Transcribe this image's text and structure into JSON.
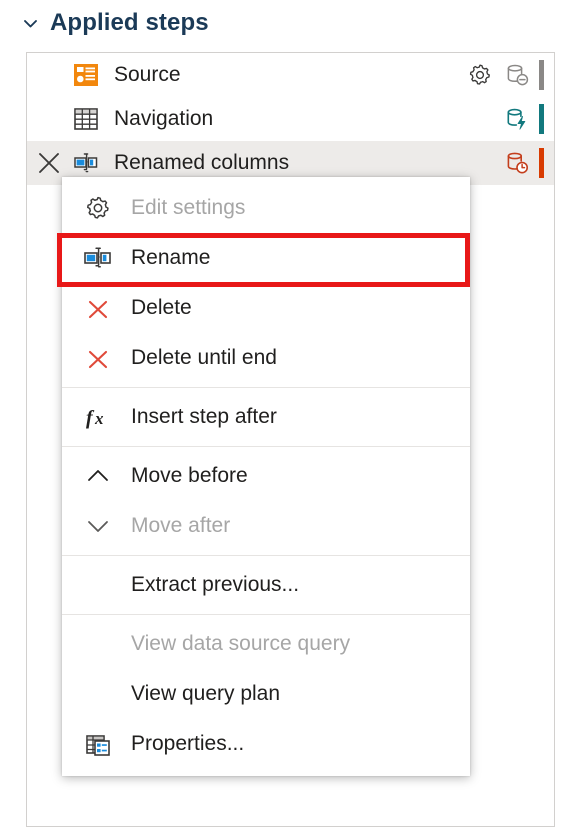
{
  "header": {
    "title": "Applied steps",
    "chevron_icon": "chevron-down-icon",
    "title_color": "#1b3a57"
  },
  "steps_panel": {
    "border_color": "#d2d0ce",
    "selected_row_bg": "#edebe9",
    "steps": [
      {
        "label": "Source",
        "type_icon": "source-orange-icon",
        "type_icon_color": "#f2870d",
        "has_gear": true,
        "gear_icon": "gear-icon",
        "status_icon": "database-disabled-icon",
        "status_color": "#8a8886",
        "accent_color": "#8a8886",
        "selected": false,
        "has_delete": false
      },
      {
        "label": "Navigation",
        "type_icon": "table-grid-icon",
        "type_icon_color": "#3b3a39",
        "has_gear": false,
        "gear_icon": "",
        "status_icon": "database-folding-icon",
        "status_color": "#12797e",
        "accent_color": "#12797e",
        "selected": false,
        "has_delete": false
      },
      {
        "label": "Renamed columns",
        "type_icon": "rename-columns-icon",
        "type_icon_color": "#0f6cbd",
        "has_gear": false,
        "gear_icon": "",
        "status_icon": "database-pending-icon",
        "status_color": "#c43e1c",
        "accent_color": "#d83b01",
        "selected": true,
        "has_delete": true,
        "delete_icon": "close-x-icon"
      }
    ]
  },
  "context_menu": {
    "highlight_color": "#e81818",
    "highlighted_item": "Rename",
    "items": [
      {
        "kind": "item",
        "label": "Edit settings",
        "icon": "gear-icon",
        "disabled": true
      },
      {
        "kind": "item",
        "label": "Rename",
        "icon": "rename-icon",
        "disabled": false,
        "highlighted": true
      },
      {
        "kind": "item",
        "label": "Delete",
        "icon": "delete-x-icon",
        "disabled": false
      },
      {
        "kind": "item",
        "label": "Delete until end",
        "icon": "delete-x-icon",
        "disabled": false
      },
      {
        "kind": "separator"
      },
      {
        "kind": "item",
        "label": "Insert step after",
        "icon": "fx-function-icon",
        "disabled": false
      },
      {
        "kind": "separator"
      },
      {
        "kind": "item",
        "label": "Move before",
        "icon": "chevron-up-icon",
        "disabled": false
      },
      {
        "kind": "item",
        "label": "Move after",
        "icon": "chevron-down-icon",
        "disabled": true
      },
      {
        "kind": "separator"
      },
      {
        "kind": "item",
        "label": "Extract previous...",
        "icon": "",
        "disabled": false
      },
      {
        "kind": "separator"
      },
      {
        "kind": "item",
        "label": "View data source query",
        "icon": "",
        "disabled": true
      },
      {
        "kind": "item",
        "label": "View query plan",
        "icon": "",
        "disabled": false
      },
      {
        "kind": "item",
        "label": "Properties...",
        "icon": "properties-table-icon",
        "disabled": false
      }
    ]
  }
}
